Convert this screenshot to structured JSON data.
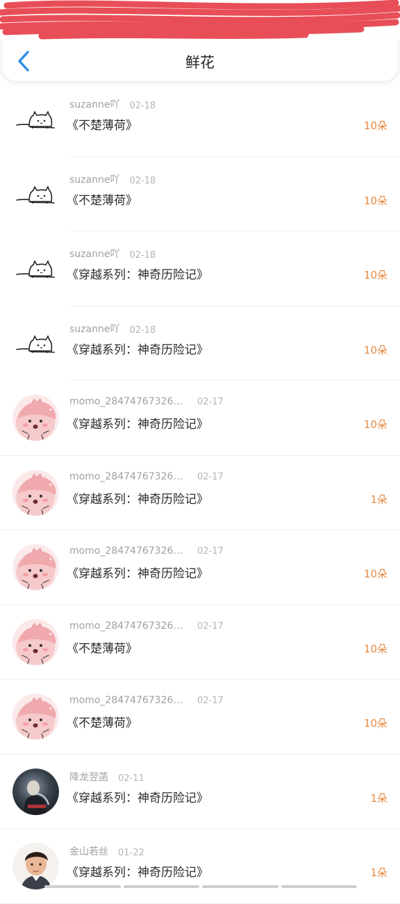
{
  "header": {
    "title": "鲜花"
  },
  "colors": {
    "accent_blue": "#2f8de4",
    "amount_orange": "#e6883e",
    "redaction_red": "#e63b45"
  },
  "icons": {
    "back": "chevron-left-icon",
    "cat_avatar": "cat-doodle-avatar",
    "pink_avatar": "pink-blob-avatar",
    "photo_avatar_1": "dark-photo-avatar",
    "photo_avatar_2": "child-photo-avatar"
  },
  "records": [
    {
      "user": "suzanne吖",
      "date": "02-18",
      "book": "《不楚薄荷》",
      "amount": "10朵",
      "avatar": "cat"
    },
    {
      "user": "suzanne吖",
      "date": "02-18",
      "book": "《不楚薄荷》",
      "amount": "10朵",
      "avatar": "cat"
    },
    {
      "user": "suzanne吖",
      "date": "02-18",
      "book": "《穿越系列：神奇历险记》",
      "amount": "10朵",
      "avatar": "cat"
    },
    {
      "user": "suzanne吖",
      "date": "02-18",
      "book": "《穿越系列：神奇历险记》",
      "amount": "10朵",
      "avatar": "cat"
    },
    {
      "user": "momo_284747673266...",
      "date": "02-17",
      "book": "《穿越系列：神奇历险记》",
      "amount": "10朵",
      "avatar": "pink"
    },
    {
      "user": "momo_284747673266...",
      "date": "02-17",
      "book": "《穿越系列：神奇历险记》",
      "amount": "1朵",
      "avatar": "pink"
    },
    {
      "user": "momo_284747673266...",
      "date": "02-17",
      "book": "《穿越系列：神奇历险记》",
      "amount": "10朵",
      "avatar": "pink"
    },
    {
      "user": "momo_284747673266...",
      "date": "02-17",
      "book": "《不楚薄荷》",
      "amount": "10朵",
      "avatar": "pink"
    },
    {
      "user": "momo_284747673266...",
      "date": "02-17",
      "book": "《不楚薄荷》",
      "amount": "10朵",
      "avatar": "pink"
    },
    {
      "user": "降龙翌菡",
      "date": "02-11",
      "book": "《穿越系列：神奇历险记》",
      "amount": "1朵",
      "avatar": "photo1"
    },
    {
      "user": "金山若丝",
      "date": "01-22",
      "book": "《穿越系列：神奇历险记》",
      "amount": "1朵",
      "avatar": "photo2"
    }
  ]
}
